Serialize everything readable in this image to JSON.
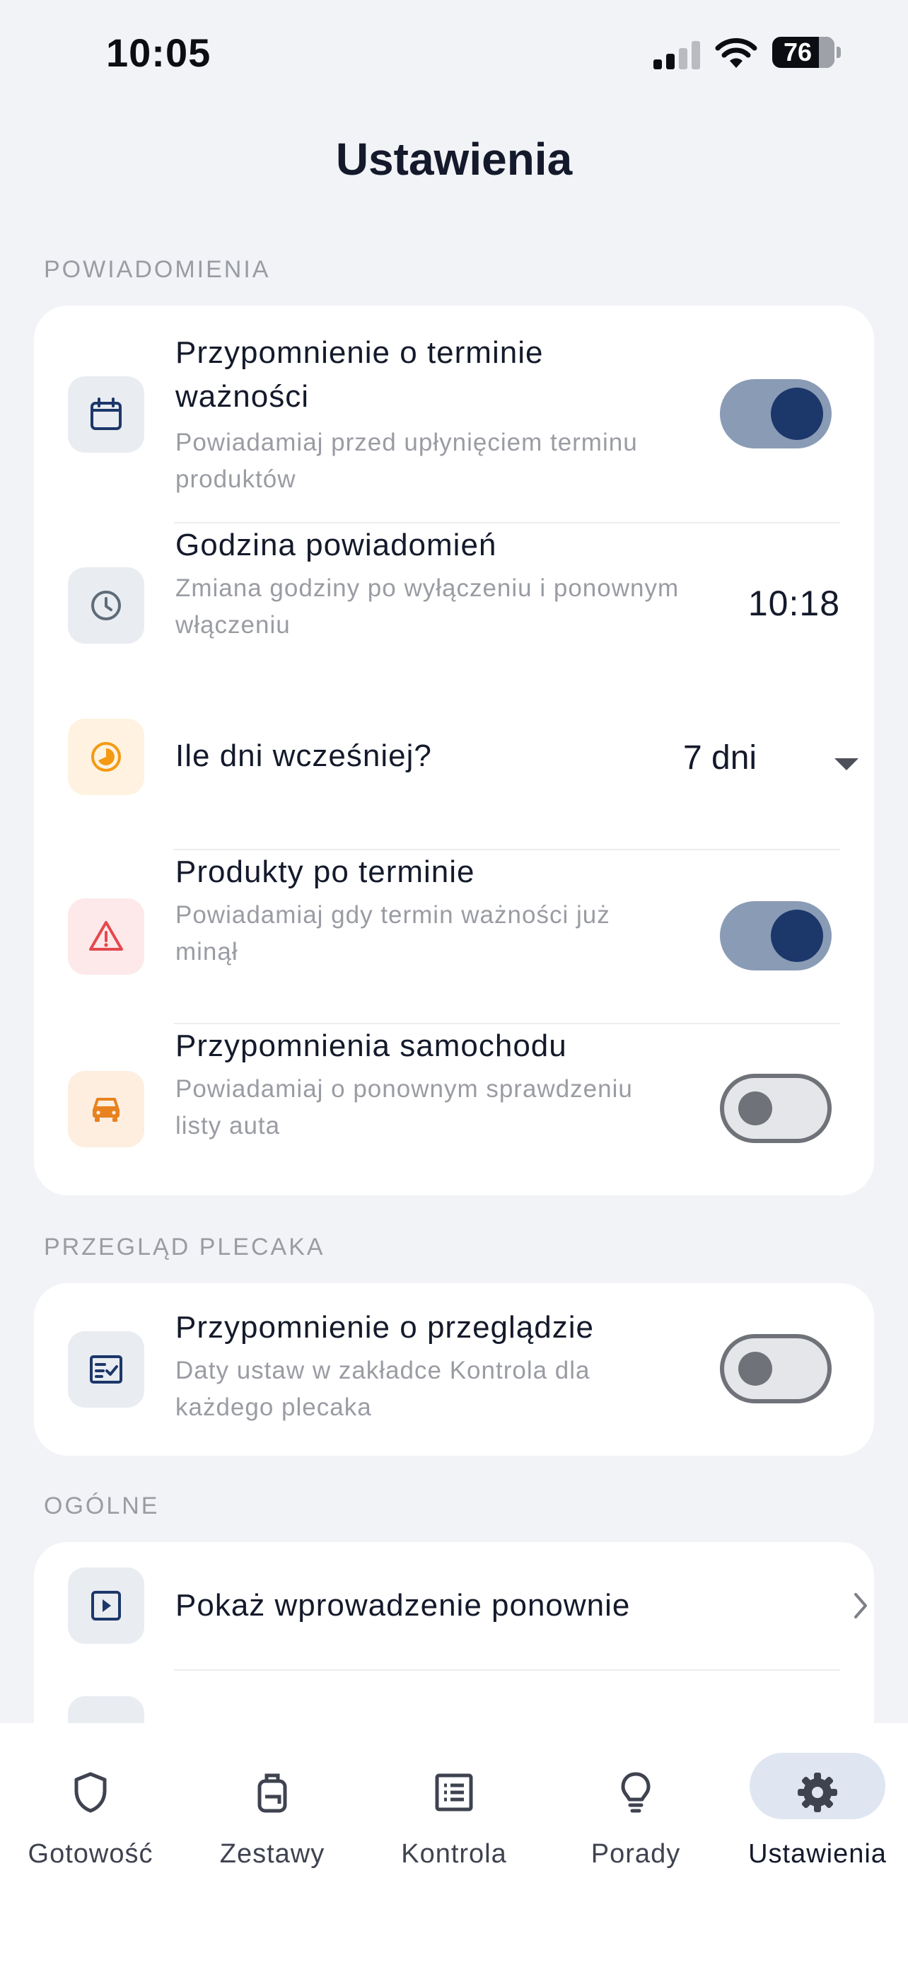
{
  "status_bar": {
    "time": "10:05",
    "battery": "76"
  },
  "page_title": "Ustawienia",
  "sections": {
    "notifications": {
      "header": "POWIADOMIENIA",
      "rows": {
        "expiry_reminder": {
          "title_line1": "Przypomnienie o terminie",
          "title_line2": "ważności",
          "sub_line1": "Powiadamiaj przed upłynięciem terminu",
          "sub_line2": "produktów",
          "toggle": "on",
          "icon": "calendar-icon"
        },
        "notify_time": {
          "title": "Godzina powiadomień",
          "sub_line1": "Zmiana godziny po wyłączeniu i ponownym",
          "sub_line2": "włączeniu",
          "value": "10:18",
          "icon": "clock-icon"
        },
        "days_before": {
          "title": "Ile dni wcześniej?",
          "value": "7 dni",
          "icon": "timer-icon"
        },
        "expired_products": {
          "title": "Produkty po terminie",
          "sub_line1": "Powiadamiaj gdy termin ważności już",
          "sub_line2": "minął",
          "toggle": "on",
          "icon": "warning-icon"
        },
        "car_reminders": {
          "title": "Przypomnienia samochodu",
          "sub_line1": "Powiadamiaj o ponownym sprawdzeniu",
          "sub_line2": "listy auta",
          "toggle": "off",
          "icon": "car-icon"
        }
      }
    },
    "backpack_review": {
      "header": "PRZEGLĄD PLECAKA",
      "rows": {
        "review_reminder": {
          "title": "Przypomnienie o przeglądzie",
          "sub_line1": "Daty ustaw w zakładce Kontrola dla",
          "sub_line2": "każdego plecaka",
          "toggle": "off",
          "icon": "checklist-icon"
        }
      }
    },
    "general": {
      "header": "OGÓLNE",
      "rows": {
        "show_intro": {
          "title": "Pokaż wprowadzenie ponownie",
          "icon": "play-icon"
        }
      }
    }
  },
  "tab_bar": {
    "tabs": [
      {
        "label": "Gotowość",
        "icon": "shield-icon"
      },
      {
        "label": "Zestawy",
        "icon": "backpack-icon"
      },
      {
        "label": "Kontrola",
        "icon": "list-icon"
      },
      {
        "label": "Porady",
        "icon": "lightbulb-icon"
      },
      {
        "label": "Ustawienia",
        "icon": "gear-icon",
        "active": true
      }
    ]
  },
  "colors": {
    "accent": "#1C376A",
    "toggle_on_track": "#8A9BB5",
    "background": "#F2F3F7"
  }
}
